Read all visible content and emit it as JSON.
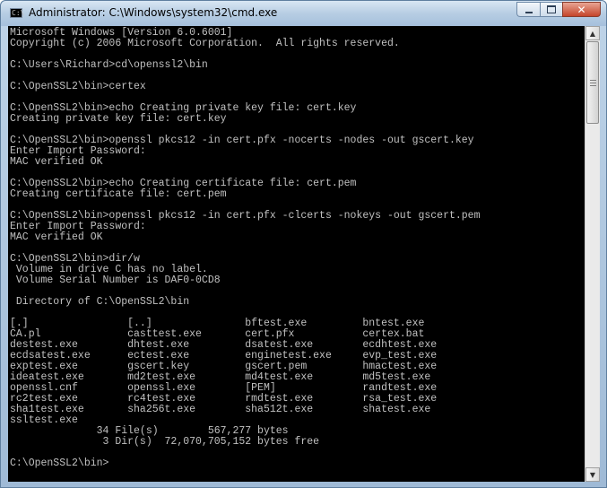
{
  "window": {
    "title": "Administrator: C:\\Windows\\system32\\cmd.exe",
    "icon_text": "C:\\"
  },
  "controls": {
    "minimize_icon": "minimize-icon",
    "maximize_icon": "maximize-icon",
    "close_icon": "close-icon",
    "close_glyph": "✕"
  },
  "scrollbar": {
    "up_arrow": "▲",
    "down_arrow": "▼"
  },
  "console": {
    "lines": [
      "Microsoft Windows [Version 6.0.6001]",
      "Copyright (c) 2006 Microsoft Corporation.  All rights reserved.",
      "",
      "C:\\Users\\Richard>cd\\openssl2\\bin",
      "",
      "C:\\OpenSSL2\\bin>certex",
      "",
      "C:\\OpenSSL2\\bin>echo Creating private key file: cert.key",
      "Creating private key file: cert.key",
      "",
      "C:\\OpenSSL2\\bin>openssl pkcs12 -in cert.pfx -nocerts -nodes -out gscert.key",
      "Enter Import Password:",
      "MAC verified OK",
      "",
      "C:\\OpenSSL2\\bin>echo Creating certificate file: cert.pem",
      "Creating certificate file: cert.pem",
      "",
      "C:\\OpenSSL2\\bin>openssl pkcs12 -in cert.pfx -clcerts -nokeys -out gscert.pem",
      "Enter Import Password:",
      "MAC verified OK",
      "",
      "C:\\OpenSSL2\\bin>dir/w",
      " Volume in drive C has no label.",
      " Volume Serial Number is DAF0-0CD8",
      "",
      " Directory of C:\\OpenSSL2\\bin",
      "",
      "[.]                [..]               bftest.exe         bntest.exe",
      "CA.pl              casttest.exe       cert.pfx           certex.bat",
      "destest.exe        dhtest.exe         dsatest.exe        ecdhtest.exe",
      "ecdsatest.exe      ectest.exe         enginetest.exe     evp_test.exe",
      "exptest.exe        gscert.key         gscert.pem         hmactest.exe",
      "ideatest.exe       md2test.exe        md4test.exe        md5test.exe",
      "openssl.cnf        openssl.exe        [PEM]              randtest.exe",
      "rc2test.exe        rc4test.exe        rmdtest.exe        rsa_test.exe",
      "sha1test.exe       sha256t.exe        sha512t.exe        shatest.exe",
      "ssltest.exe",
      "              34 File(s)        567,277 bytes",
      "               3 Dir(s)  72,070,705,152 bytes free",
      "",
      "C:\\OpenSSL2\\bin>"
    ]
  }
}
